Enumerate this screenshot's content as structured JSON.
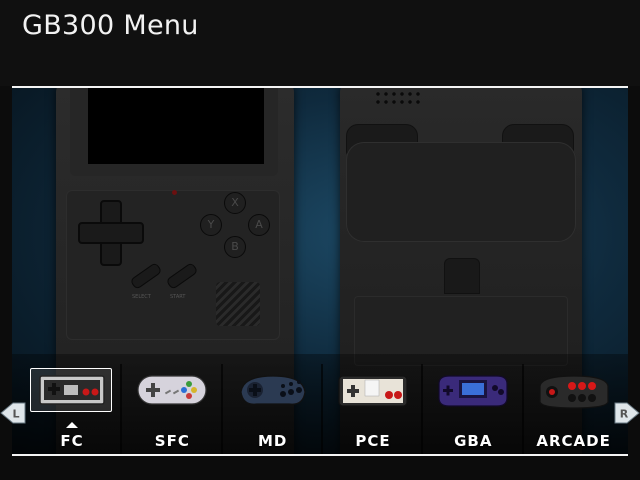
{
  "header": {
    "title": "GB300 Menu"
  },
  "device_front": {
    "select_label": "SELECT",
    "start_label": "START",
    "buttons": [
      "X",
      "Y",
      "A",
      "B"
    ]
  },
  "navigation": {
    "left_label": "L",
    "right_label": "R"
  },
  "consoles": [
    {
      "label": "FC",
      "icon": "nes-controller-icon",
      "selected": true
    },
    {
      "label": "SFC",
      "icon": "snes-controller-icon",
      "selected": false
    },
    {
      "label": "MD",
      "icon": "megadrive-controller-icon",
      "selected": false
    },
    {
      "label": "PCE",
      "icon": "pce-controller-icon",
      "selected": false
    },
    {
      "label": "GBA",
      "icon": "gba-handheld-icon",
      "selected": false
    },
    {
      "label": "ARCADE",
      "icon": "arcade-stick-icon",
      "selected": false
    }
  ],
  "colors": {
    "background": "#0c0c0c",
    "stage": "#0f2a3d",
    "text": "#ffffff",
    "gba": "#3a2a7a",
    "arcade_red": "#d81818"
  }
}
